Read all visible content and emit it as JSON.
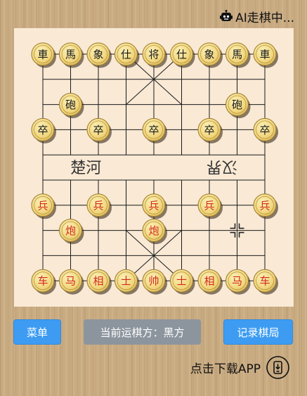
{
  "status": {
    "text": "AI走棋中...",
    "icon": "robot-icon"
  },
  "board": {
    "river_left": "楚河",
    "river_right": "汉界",
    "pieces": [
      {
        "side": "black",
        "char": "車",
        "col": 0,
        "row": 0
      },
      {
        "side": "black",
        "char": "馬",
        "col": 1,
        "row": 0
      },
      {
        "side": "black",
        "char": "象",
        "col": 2,
        "row": 0
      },
      {
        "side": "black",
        "char": "仕",
        "col": 3,
        "row": 0
      },
      {
        "side": "black",
        "char": "将",
        "col": 4,
        "row": 0
      },
      {
        "side": "black",
        "char": "仕",
        "col": 5,
        "row": 0
      },
      {
        "side": "black",
        "char": "象",
        "col": 6,
        "row": 0
      },
      {
        "side": "black",
        "char": "馬",
        "col": 7,
        "row": 0
      },
      {
        "side": "black",
        "char": "車",
        "col": 8,
        "row": 0
      },
      {
        "side": "black",
        "char": "砲",
        "col": 1,
        "row": 2
      },
      {
        "side": "black",
        "char": "砲",
        "col": 7,
        "row": 2
      },
      {
        "side": "black",
        "char": "卒",
        "col": 0,
        "row": 3
      },
      {
        "side": "black",
        "char": "卒",
        "col": 2,
        "row": 3
      },
      {
        "side": "black",
        "char": "卒",
        "col": 4,
        "row": 3
      },
      {
        "side": "black",
        "char": "卒",
        "col": 6,
        "row": 3
      },
      {
        "side": "black",
        "char": "卒",
        "col": 8,
        "row": 3
      },
      {
        "side": "red",
        "char": "兵",
        "col": 0,
        "row": 6
      },
      {
        "side": "red",
        "char": "兵",
        "col": 2,
        "row": 6
      },
      {
        "side": "red",
        "char": "兵",
        "col": 4,
        "row": 6
      },
      {
        "side": "red",
        "char": "兵",
        "col": 6,
        "row": 6
      },
      {
        "side": "red",
        "char": "兵",
        "col": 8,
        "row": 6
      },
      {
        "side": "red",
        "char": "炮",
        "col": 1,
        "row": 7
      },
      {
        "side": "red",
        "char": "炮",
        "col": 4,
        "row": 7
      },
      {
        "side": "red",
        "char": "车",
        "col": 0,
        "row": 9
      },
      {
        "side": "red",
        "char": "马",
        "col": 1,
        "row": 9
      },
      {
        "side": "red",
        "char": "相",
        "col": 2,
        "row": 9
      },
      {
        "side": "red",
        "char": "士",
        "col": 3,
        "row": 9
      },
      {
        "side": "red",
        "char": "帅",
        "col": 4,
        "row": 9
      },
      {
        "side": "red",
        "char": "士",
        "col": 5,
        "row": 9
      },
      {
        "side": "red",
        "char": "相",
        "col": 6,
        "row": 9
      },
      {
        "side": "red",
        "char": "马",
        "col": 7,
        "row": 9
      },
      {
        "side": "red",
        "char": "车",
        "col": 8,
        "row": 9
      }
    ],
    "last_move_marker": {
      "col": 7,
      "row": 7
    }
  },
  "buttons": {
    "menu": "菜单",
    "turn": "当前运棋方：黑方",
    "record": "记录棋局"
  },
  "download": {
    "label": "点击下载APP",
    "icon": "phone-download-icon"
  },
  "colors": {
    "button_blue": "#3d9cf2",
    "button_gray": "#8c959e",
    "board_bg": "#f9e9d5",
    "piece_face": "#f6e38f",
    "red_text": "#d42a1c",
    "black_text": "#1a1a1a"
  }
}
